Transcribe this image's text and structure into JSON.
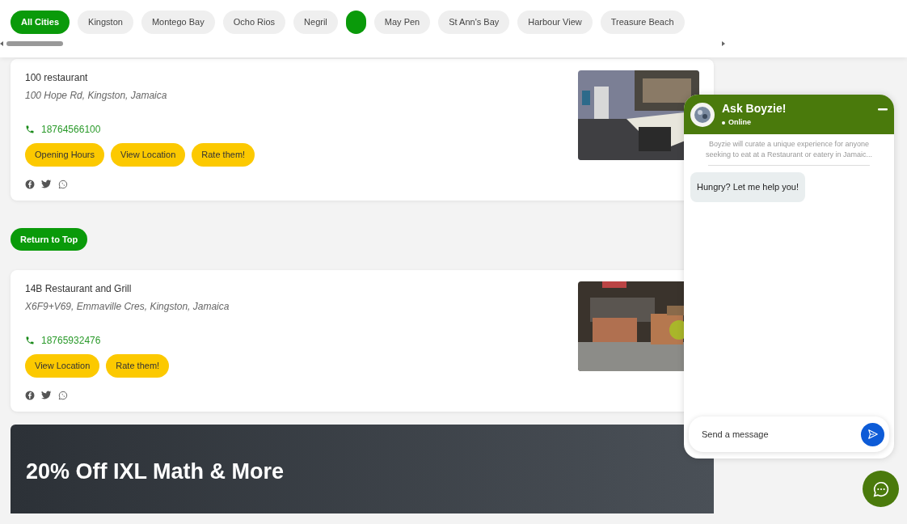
{
  "city_filter": {
    "chips": [
      {
        "kind": "label",
        "label": "All Cities",
        "selected": true
      },
      {
        "kind": "label",
        "label": "Kingston",
        "selected": false
      },
      {
        "kind": "label",
        "label": "Montego Bay",
        "selected": false
      },
      {
        "kind": "label",
        "label": "Ocho Rios",
        "selected": false
      },
      {
        "kind": "label",
        "label": "Negril",
        "selected": false
      },
      {
        "kind": "blank",
        "selected": true
      },
      {
        "kind": "label",
        "label": "May Pen",
        "selected": false
      },
      {
        "kind": "label",
        "label": "St Ann's Bay",
        "selected": false
      },
      {
        "kind": "label",
        "label": "Harbour View",
        "selected": false
      },
      {
        "kind": "label",
        "label": "Treasure Beach",
        "selected": false
      }
    ]
  },
  "listings": [
    {
      "name": "100 restaurant",
      "address": "100 Hope Rd, Kingston, Jamaica",
      "phone": "18764566100",
      "buttons": [
        "Opening Hours",
        "View Location",
        "Rate them!"
      ],
      "photo": {
        "kind": "picture"
      }
    },
    {
      "name": "14B Restaurant and Grill",
      "address": "X6F9+V69, Emmaville Cres, Kingston, Jamaica",
      "phone": "18765932476",
      "buttons": [
        "View Location",
        "Rate them!"
      ],
      "photo": {
        "kind": "picture"
      }
    }
  ],
  "return_button": "Return to Top",
  "banner": {
    "title": "20% Off IXL Math & More"
  },
  "chat": {
    "title": "Ask Boyzie!",
    "status": "Online",
    "intro": "Boyzie will curate a unique experience for anyone seeking to eat at a Restaurant or eatery in Jamaic...",
    "messages": [
      "Hungry? Let me help you!"
    ],
    "input": {
      "placeholder": "Send a message"
    }
  }
}
